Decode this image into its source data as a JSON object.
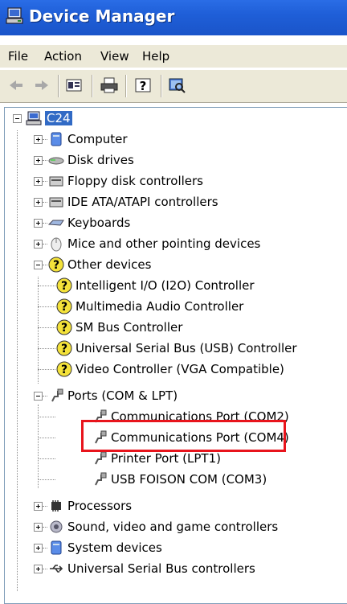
{
  "window": {
    "title": "Device Manager"
  },
  "menu": [
    "File",
    "Action",
    "View",
    "Help"
  ],
  "toolbar": {
    "buttons": [
      "back-icon",
      "forward-icon",
      "properties-icon",
      "print-icon",
      "help-icon",
      "scan-hardware-icon"
    ]
  },
  "tree": {
    "root": "C24",
    "categories": [
      {
        "label": "Computer",
        "icon": "computer-icon",
        "expanded": false
      },
      {
        "label": "Disk drives",
        "icon": "disk-drive-icon",
        "expanded": false
      },
      {
        "label": "Floppy disk controllers",
        "icon": "floppy-controller-icon",
        "expanded": false
      },
      {
        "label": "IDE ATA/ATAPI controllers",
        "icon": "ide-controller-icon",
        "expanded": false
      },
      {
        "label": "Keyboards",
        "icon": "keyboard-icon",
        "expanded": false
      },
      {
        "label": "Mice and other pointing devices",
        "icon": "mouse-icon",
        "expanded": false
      },
      {
        "label": "Other devices",
        "icon": "unknown-device-icon",
        "expanded": true,
        "children": [
          "Intelligent I/O (I2O) Controller",
          "Multimedia Audio Controller",
          "SM Bus Controller",
          "Universal Serial Bus (USB) Controller",
          "Video Controller (VGA Compatible)"
        ]
      },
      {
        "label": "Ports (COM & LPT)",
        "icon": "port-icon",
        "expanded": true,
        "children": [
          "Communications Port (COM2)",
          "Communications Port (COM4)",
          "Printer Port (LPT1)",
          "USB FOISON COM (COM3)"
        ]
      },
      {
        "label": "Processors",
        "icon": "processor-icon",
        "expanded": false
      },
      {
        "label": "Sound, video and game controllers",
        "icon": "sound-icon",
        "expanded": false
      },
      {
        "label": "System devices",
        "icon": "system-devices-icon",
        "expanded": false
      },
      {
        "label": "Universal Serial Bus controllers",
        "icon": "usb-icon",
        "expanded": false
      }
    ]
  },
  "highlighted_item": "Communications Port (COM4)",
  "colors": {
    "title_bar": "#1f5fd8",
    "selection": "#316ac5",
    "highlight_box": "#e8141c",
    "chrome": "#ece9d8"
  }
}
